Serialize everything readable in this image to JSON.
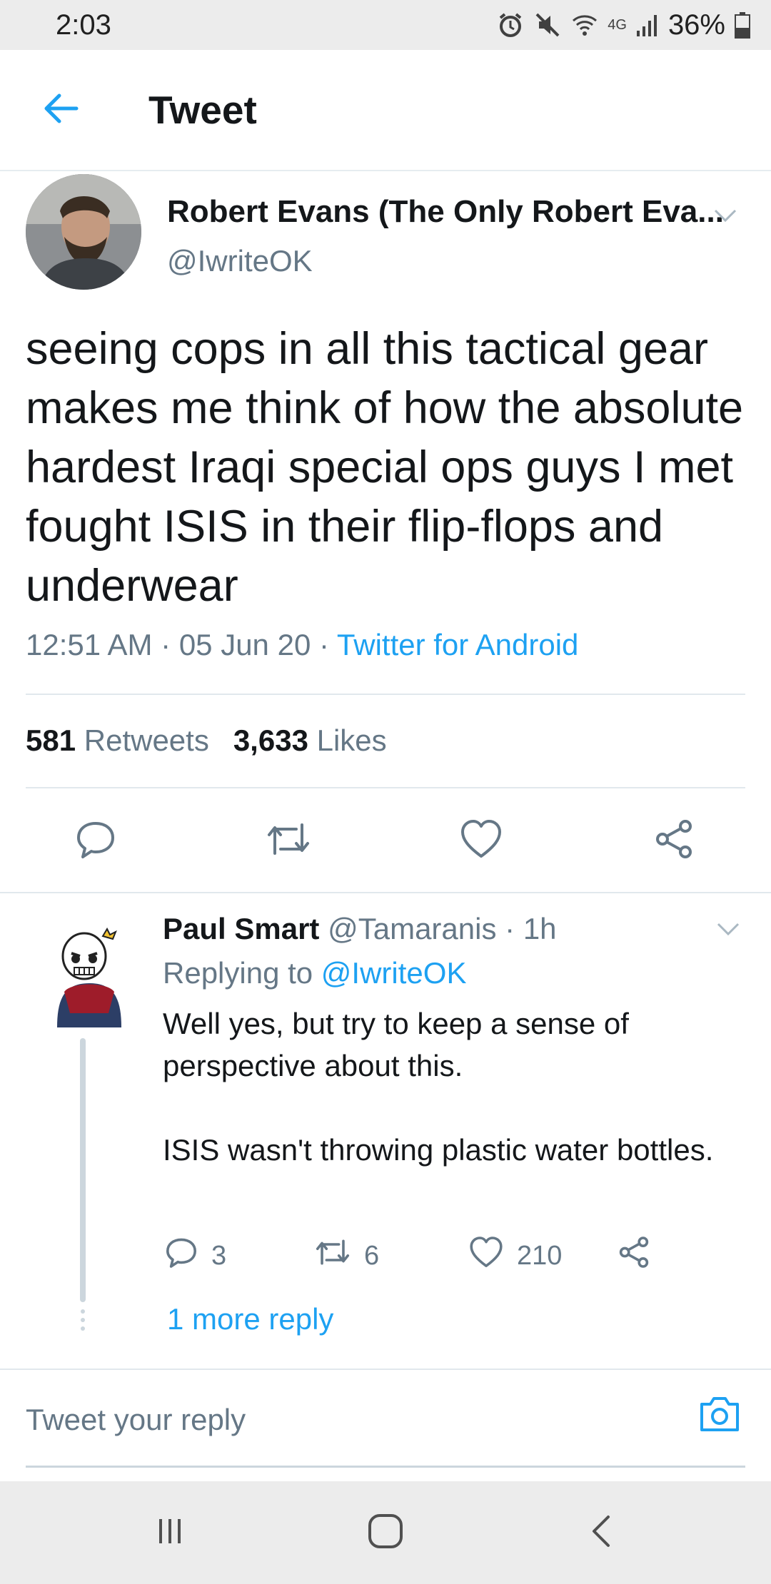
{
  "status_bar": {
    "time": "2:03",
    "network": "4G",
    "battery": "36%"
  },
  "app_bar": {
    "title": "Tweet"
  },
  "tweet": {
    "author_name": "Robert Evans (The Only Robert Eva...",
    "author_handle": "@IwriteOK",
    "text": "seeing cops in all this tactical gear makes me think of how the absolute hardest Iraqi special ops guys I met fought ISIS in their flip-flops and underwear",
    "time": "12:51 AM",
    "date": "05 Jun 20",
    "separator": "·",
    "source": "Twitter for Android",
    "retweets_count": "581",
    "retweets_label": "Retweets",
    "likes_count": "3,633",
    "likes_label": "Likes"
  },
  "reply": {
    "author_name": "Paul Smart",
    "author_handle": "@Tamaranis",
    "separator": "·",
    "time": "1h",
    "replying_prefix": "Replying to",
    "replying_to": "@IwriteOK",
    "text": "Well yes, but try to keep a sense of perspective about this.\n\nISIS wasn't throwing plastic water bottles.",
    "reply_count": "3",
    "retweet_count": "6",
    "like_count": "210",
    "more_replies": "1 more reply"
  },
  "compose": {
    "placeholder": "Tweet your reply"
  },
  "colors": {
    "accent": "#1da1f2",
    "secondary_text": "#657786",
    "primary_text": "#14171a",
    "divider": "#e1e8ed"
  },
  "icons": {
    "back": "arrow-left-icon",
    "caret": "chevron-down-icon",
    "reply": "speech-bubble-icon",
    "retweet": "retweet-icon",
    "like": "heart-icon",
    "share": "share-icon",
    "camera": "camera-icon"
  }
}
